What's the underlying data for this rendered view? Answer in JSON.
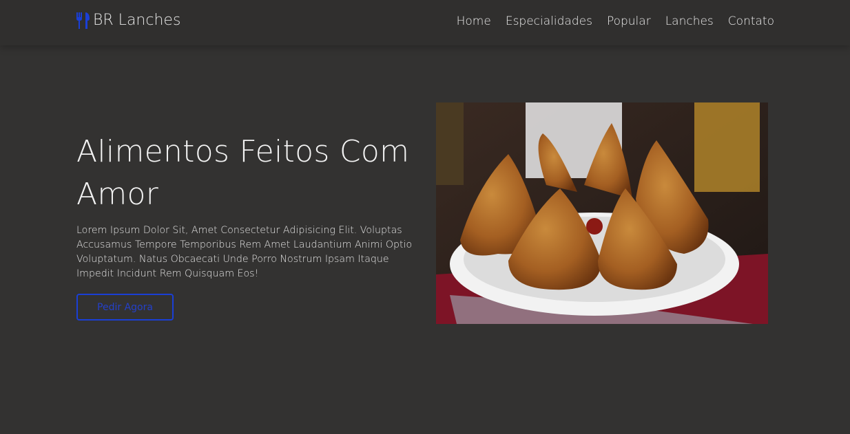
{
  "brand": {
    "name": "BR Lanches",
    "icon": "utensils-icon",
    "color": "#1a3fd6"
  },
  "nav": [
    {
      "label": "Home"
    },
    {
      "label": "Especialidades"
    },
    {
      "label": "Popular"
    },
    {
      "label": "Lanches"
    },
    {
      "label": "Contato"
    }
  ],
  "hero": {
    "title": "Alimentos Feitos Com Amor",
    "description": "Lorem Ipsum Dolor Sit, Amet Consectetur Adipisicing Elit. Voluptas Accusamus Tempore Temporibus Rem Amet Laudantium Animi Optio Voluptatum. Natus Obcaecati Unde Porro Nostrum Ipsam Itaque Impedit Incidunt Rem Quisquam Eos!",
    "button": "Pedir Agora"
  }
}
